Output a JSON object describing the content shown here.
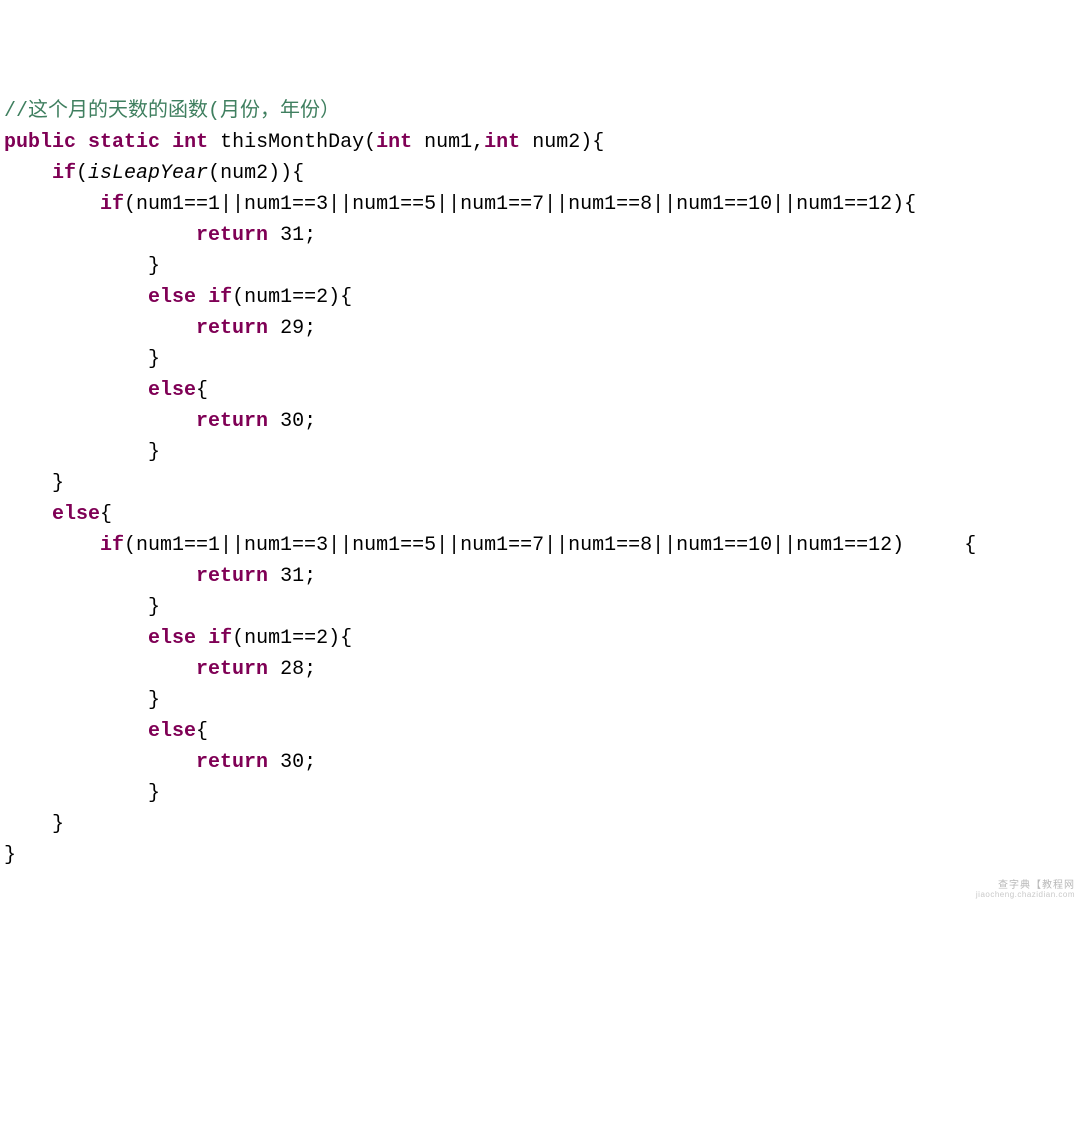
{
  "lines": {
    "0": {
      "slash": "//",
      "cn1": "这个月的天数的函数",
      "paren1": "(",
      "cn2": "月份，年份",
      "paren2": "）"
    }
  },
  "tokens": {
    "public": "public",
    "static": "static",
    "int": "int",
    "methodName": "thisMonthDay",
    "sigOpen": "(",
    "sigP1": " num1,",
    "sigP2": " num2){",
    "if": "if",
    "ifLeapOpen": "(",
    "isLeapYear": "isLeapYear",
    "ifLeapClose": "(num2)){",
    "monthCond1": "(num1==1||num1==3||num1==5||num1==7||num1==8||num1==10||num1==12){",
    "monthCond2": "(num1==1||num1==3||num1==5||num1==7||num1==8||num1==10||num1==12)",
    "febCond": "(num1==2){",
    "return": "return",
    "sp": " ",
    "v31": "31",
    "v30": "30",
    "v29": "29",
    "v28": "28",
    "semi": ";",
    "else": "else",
    "lbrace": "{",
    "rbrace": "}"
  },
  "watermark": {
    "line1": "查字典【教程网",
    "line2": "jiaocheng.chazidian.com"
  }
}
